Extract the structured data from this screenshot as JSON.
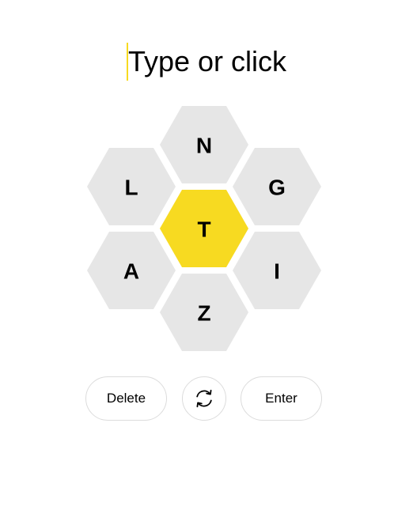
{
  "input": {
    "placeholder": "Type or click"
  },
  "hive": {
    "center": {
      "letter": "T",
      "color": "#f7da21"
    },
    "outer_color": "#e6e6e6",
    "outer": [
      {
        "position": "top",
        "letter": "N"
      },
      {
        "position": "upper-left",
        "letter": "L"
      },
      {
        "position": "upper-right",
        "letter": "G"
      },
      {
        "position": "lower-left",
        "letter": "A"
      },
      {
        "position": "lower-right",
        "letter": "I"
      },
      {
        "position": "bottom",
        "letter": "Z"
      }
    ]
  },
  "controls": {
    "delete_label": "Delete",
    "shuffle_icon": "shuffle-icon",
    "enter_label": "Enter"
  }
}
